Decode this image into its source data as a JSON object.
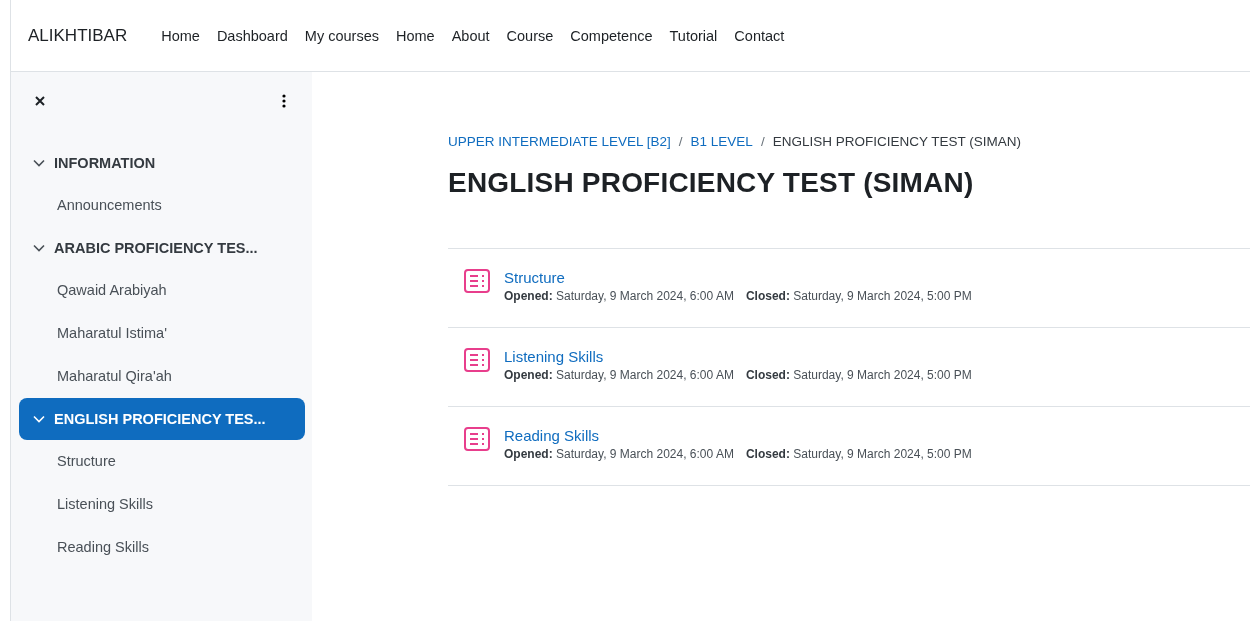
{
  "navbar": {
    "brand": "ALIKHTIBAR",
    "links": [
      "Home",
      "Dashboard",
      "My courses",
      "Home",
      "About",
      "Course",
      "Competence",
      "Tutorial",
      "Contact"
    ]
  },
  "sidebar": {
    "sections": [
      {
        "title": "INFORMATION",
        "expanded": true,
        "selected": false,
        "items": [
          {
            "label": "Announcements"
          }
        ]
      },
      {
        "title": "ARABIC PROFICIENCY TES...",
        "expanded": true,
        "selected": false,
        "items": [
          {
            "label": "Qawaid Arabiyah"
          },
          {
            "label": "Maharatul Istima'"
          },
          {
            "label": "Maharatul Qira'ah"
          }
        ]
      },
      {
        "title": "ENGLISH PROFICIENCY TES...",
        "expanded": true,
        "selected": true,
        "items": [
          {
            "label": "Structure"
          },
          {
            "label": "Listening Skills"
          },
          {
            "label": "Reading Skills"
          }
        ]
      }
    ]
  },
  "breadcrumb": {
    "separator": "/",
    "items": [
      {
        "label": "UPPER INTERMEDIATE LEVEL [B2]",
        "kind": "link"
      },
      {
        "label": "B1 LEVEL",
        "kind": "link"
      },
      {
        "label": "ENGLISH PROFICIENCY TEST (SIMAN)",
        "kind": "current"
      }
    ]
  },
  "page_title": "ENGLISH PROFICIENCY TEST (SIMAN)",
  "activities": [
    {
      "name": "Structure",
      "opened": "**Opened:** Saturday, 9 March 2024, 6:00 AM",
      "closed": "**Closed:** Saturday, 9 March 2024, 5:00 PM"
    },
    {
      "name": "Listening Skills",
      "opened": "**Opened:** Saturday, 9 March 2024, 6:00 AM",
      "closed": "**Closed:** Saturday, 9 March 2024, 5:00 PM"
    },
    {
      "name": "Reading Skills",
      "opened": "**Opened:** Saturday, 9 March 2024, 6:00 AM",
      "closed": "**Closed:** Saturday, 9 March 2024, 5:00 PM"
    }
  ]
}
